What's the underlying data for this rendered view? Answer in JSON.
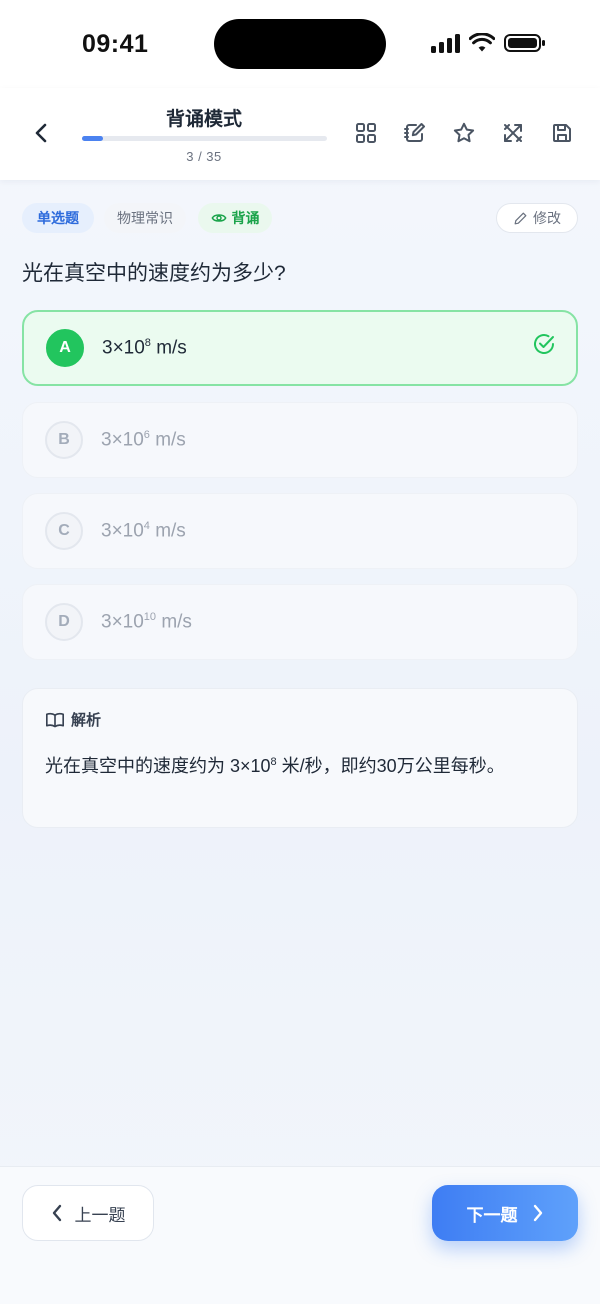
{
  "status_bar": {
    "time": "09:41"
  },
  "header": {
    "title": "背诵模式",
    "progress_text": "3 / 35",
    "progress_fraction": 0.0857,
    "icons": [
      "grid-icon",
      "notebook-edit-icon",
      "star-icon",
      "shuffle-icon",
      "save-icon"
    ]
  },
  "tags": {
    "type": "单选题",
    "category": "物理常识",
    "mode": "背诵"
  },
  "edit": {
    "label": "修改"
  },
  "question": "光在真空中的速度约为多少?",
  "options": [
    {
      "letter": "A",
      "base": "3×10",
      "exp": "8",
      "unit": " m/s",
      "state": "correct"
    },
    {
      "letter": "B",
      "base": "3×10",
      "exp": "6",
      "unit": " m/s",
      "state": "normal"
    },
    {
      "letter": "C",
      "base": "3×10",
      "exp": "4",
      "unit": " m/s",
      "state": "normal"
    },
    {
      "letter": "D",
      "base": "3×10",
      "exp": "10",
      "unit": " m/s",
      "state": "normal"
    }
  ],
  "analysis": {
    "title": "解析",
    "text_before": "光在真空中的速度约为 3×10",
    "text_exp": "8",
    "text_after": " 米/秒，即约30万公里每秒。"
  },
  "footer": {
    "prev_label": "上一题",
    "next_label": "下一题"
  },
  "colors": {
    "accent": "#3e7df3",
    "correct": "#22c55e",
    "correct_bg": "#ebfbf0"
  }
}
